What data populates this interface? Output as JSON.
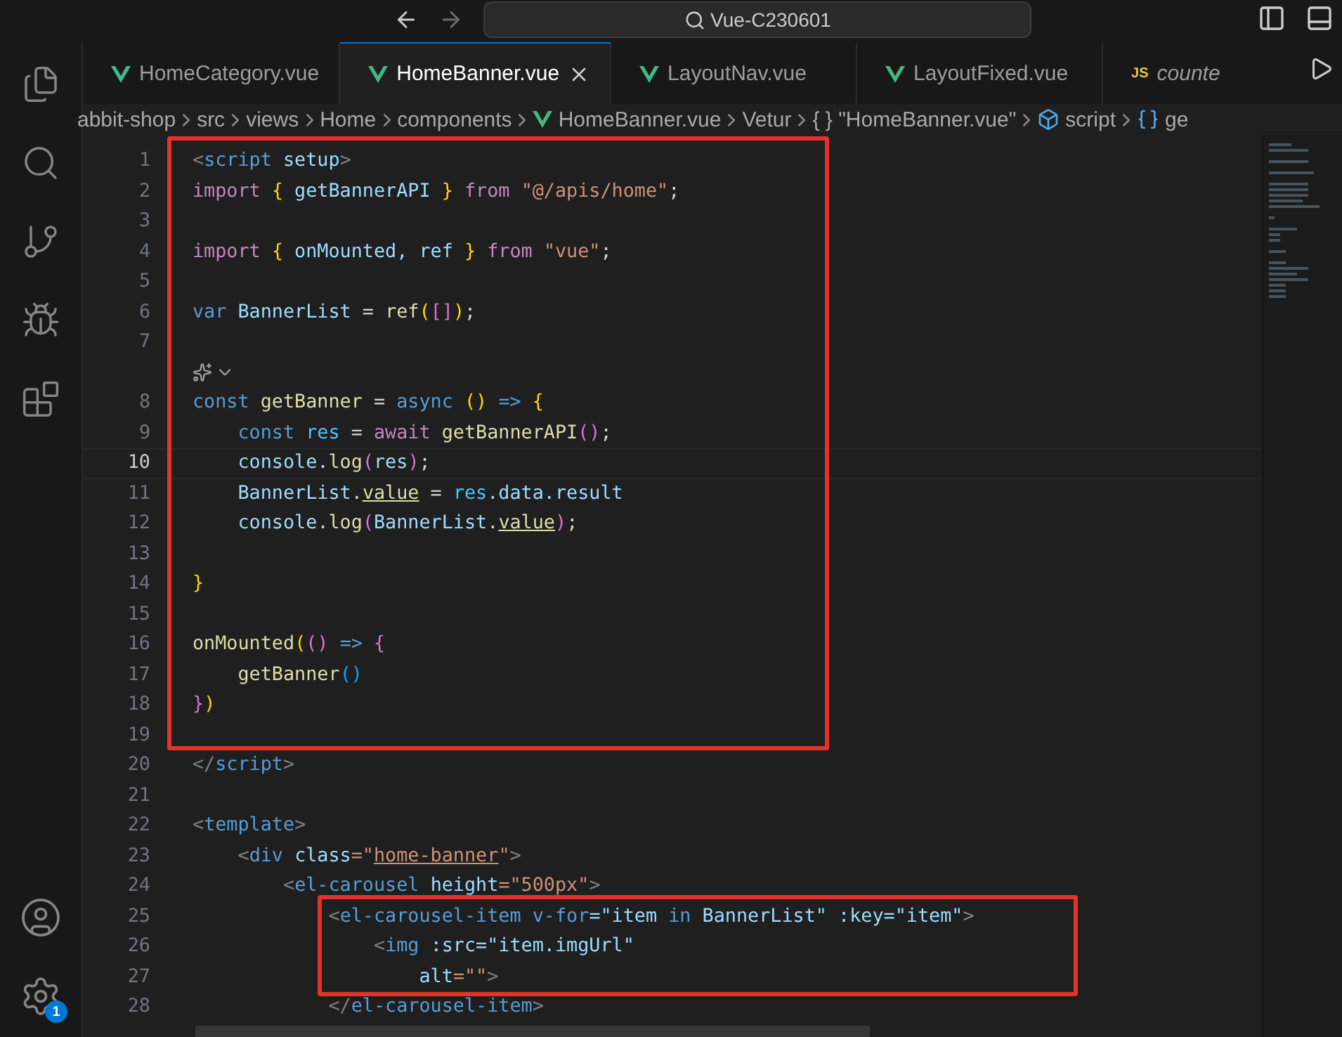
{
  "title_bar": {
    "search": "Vue-C230601"
  },
  "activity_bar": {
    "badge": "1"
  },
  "tabs": [
    {
      "label": "HomeCategory.vue",
      "kind": "vue",
      "selected": false
    },
    {
      "label": "HomeBanner.vue",
      "kind": "vue",
      "selected": true
    },
    {
      "label": "LayoutNav.vue",
      "kind": "vue",
      "selected": false
    },
    {
      "label": "LayoutFixed.vue",
      "kind": "vue",
      "selected": false
    },
    {
      "label": "counte",
      "kind": "js",
      "badge": "JS",
      "selected": false
    }
  ],
  "breadcrumb": [
    {
      "label": "abbit-shop",
      "kind": "plain"
    },
    {
      "label": "src",
      "kind": "plain"
    },
    {
      "label": "views",
      "kind": "plain"
    },
    {
      "label": "Home",
      "kind": "plain"
    },
    {
      "label": "components",
      "kind": "plain"
    },
    {
      "label": "HomeBanner.vue",
      "kind": "vue"
    },
    {
      "label": "Vetur",
      "kind": "plain"
    },
    {
      "label": "\"HomeBanner.vue\"",
      "kind": "braces",
      "prefix": "{ }"
    },
    {
      "label": "script",
      "kind": "cube"
    },
    {
      "label": "ge",
      "kind": "symbol"
    }
  ],
  "code_lines": [
    {
      "number": "1",
      "current": false,
      "tokens": [
        {
          "text": "<",
          "kind": "tag"
        },
        {
          "text": "script ",
          "kind": "tagname"
        },
        {
          "text": "setup",
          "kind": "attr"
        },
        {
          "text": ">",
          "kind": "tag"
        }
      ]
    },
    {
      "number": "2",
      "current": false,
      "tokens": [
        {
          "text": "import ",
          "kind": "kw"
        },
        {
          "text": "{",
          "kind": "b1"
        },
        {
          "text": " getBannerAPI ",
          "kind": "var"
        },
        {
          "text": "}",
          "kind": "b1"
        },
        {
          "text": " from ",
          "kind": "kw"
        },
        {
          "text": "\"@/apis/home\"",
          "kind": "str"
        },
        {
          "text": ";",
          "kind": "plain"
        }
      ]
    },
    {
      "number": "3",
      "current": false
    },
    {
      "number": "4",
      "current": false,
      "tokens": [
        {
          "text": "import ",
          "kind": "kw"
        },
        {
          "text": "{",
          "kind": "b1"
        },
        {
          "text": " onMounted, ref ",
          "kind": "var"
        },
        {
          "text": "}",
          "kind": "b1"
        },
        {
          "text": " from ",
          "kind": "kw"
        },
        {
          "text": "\"vue\"",
          "kind": "str"
        },
        {
          "text": ";",
          "kind": "plain"
        }
      ]
    },
    {
      "number": "5",
      "current": false
    },
    {
      "number": "6",
      "current": false,
      "tokens": [
        {
          "text": "var ",
          "kind": "decl"
        },
        {
          "text": "BannerList",
          "kind": "var"
        },
        {
          "text": " = ",
          "kind": "plain"
        },
        {
          "text": "ref",
          "kind": "fn"
        },
        {
          "text": "(",
          "kind": "b1"
        },
        {
          "text": "[]",
          "kind": "b2"
        },
        {
          "text": ")",
          "kind": "b1"
        },
        {
          "text": ";",
          "kind": "plain"
        }
      ]
    },
    {
      "number": "7",
      "current": false
    },
    {
      "number": "8",
      "current": false,
      "lens": true,
      "tokens": [
        {
          "text": "const ",
          "kind": "decl"
        },
        {
          "text": "getBanner",
          "kind": "fn"
        },
        {
          "text": " = ",
          "kind": "plain"
        },
        {
          "text": "async ",
          "kind": "decl"
        },
        {
          "text": "() ",
          "kind": "b1"
        },
        {
          "text": "=> ",
          "kind": "decl"
        },
        {
          "text": "{",
          "kind": "b1"
        }
      ]
    },
    {
      "number": "9",
      "current": false,
      "tokens": [
        {
          "text": "    const ",
          "kind": "decl"
        },
        {
          "text": "res",
          "kind": "const"
        },
        {
          "text": " = ",
          "kind": "plain"
        },
        {
          "text": "await ",
          "kind": "kw"
        },
        {
          "text": "getBannerAPI",
          "kind": "fn"
        },
        {
          "text": "()",
          "kind": "b2"
        },
        {
          "text": ";",
          "kind": "plain"
        }
      ]
    },
    {
      "number": "10",
      "current": true,
      "tokens": [
        {
          "text": "    console",
          "kind": "var"
        },
        {
          "text": ".",
          "kind": "plain"
        },
        {
          "text": "log",
          "kind": "fn"
        },
        {
          "text": "(",
          "kind": "b2"
        },
        {
          "text": "res",
          "kind": "var"
        },
        {
          "text": ")",
          "kind": "b2"
        },
        {
          "text": ";",
          "kind": "plain"
        }
      ]
    },
    {
      "number": "11",
      "current": false,
      "tokens": [
        {
          "text": "    BannerList",
          "kind": "var"
        },
        {
          "text": ".",
          "kind": "plain"
        },
        {
          "text": "value",
          "kind": "under"
        },
        {
          "text": " = ",
          "kind": "plain"
        },
        {
          "text": "res",
          "kind": "const"
        },
        {
          "text": ".data.result",
          "kind": "var"
        }
      ]
    },
    {
      "number": "12",
      "current": false,
      "tokens": [
        {
          "text": "    console",
          "kind": "var"
        },
        {
          "text": ".",
          "kind": "plain"
        },
        {
          "text": "log",
          "kind": "fn"
        },
        {
          "text": "(",
          "kind": "b2"
        },
        {
          "text": "BannerList",
          "kind": "var"
        },
        {
          "text": ".",
          "kind": "plain"
        },
        {
          "text": "value",
          "kind": "under"
        },
        {
          "text": ")",
          "kind": "b2"
        },
        {
          "text": ";",
          "kind": "plain"
        }
      ]
    },
    {
      "number": "13",
      "current": false
    },
    {
      "number": "14",
      "current": false,
      "tokens": [
        {
          "text": "}",
          "kind": "b1"
        }
      ]
    },
    {
      "number": "15",
      "current": false
    },
    {
      "number": "16",
      "current": false,
      "tokens": [
        {
          "text": "onMounted",
          "kind": "fn"
        },
        {
          "text": "(",
          "kind": "b1"
        },
        {
          "text": "() ",
          "kind": "b2"
        },
        {
          "text": "=> ",
          "kind": "decl"
        },
        {
          "text": "{",
          "kind": "b2"
        }
      ]
    },
    {
      "number": "17",
      "current": false,
      "tokens": [
        {
          "text": "    getBanner",
          "kind": "fn"
        },
        {
          "text": "()",
          "kind": "b3"
        }
      ]
    },
    {
      "number": "18",
      "current": false,
      "tokens": [
        {
          "text": "}",
          "kind": "b2"
        },
        {
          "text": ")",
          "kind": "b1"
        }
      ]
    },
    {
      "number": "19",
      "current": false
    },
    {
      "number": "20",
      "current": false,
      "tokens": [
        {
          "text": "</",
          "kind": "tag"
        },
        {
          "text": "script",
          "kind": "tagname"
        },
        {
          "text": ">",
          "kind": "tag"
        }
      ]
    },
    {
      "number": "21",
      "current": false
    },
    {
      "number": "22",
      "current": false,
      "tokens": [
        {
          "text": "<",
          "kind": "tag"
        },
        {
          "text": "template",
          "kind": "tagname"
        },
        {
          "text": ">",
          "kind": "tag"
        }
      ]
    },
    {
      "number": "23",
      "current": false,
      "tokens": [
        {
          "text": "    <",
          "kind": "tag"
        },
        {
          "text": "div ",
          "kind": "tagname"
        },
        {
          "text": "class",
          "kind": "attr"
        },
        {
          "text": "=\"",
          "kind": "str"
        },
        {
          "text": "home-banner",
          "kind": "strunder"
        },
        {
          "text": "\"",
          "kind": "str"
        },
        {
          "text": ">",
          "kind": "tag"
        }
      ]
    },
    {
      "number": "24",
      "current": false,
      "tokens": [
        {
          "text": "        <",
          "kind": "tag"
        },
        {
          "text": "el-carousel ",
          "kind": "tagname"
        },
        {
          "text": "height",
          "kind": "attr"
        },
        {
          "text": "=\"500px\"",
          "kind": "str"
        },
        {
          "text": ">",
          "kind": "tag"
        }
      ]
    },
    {
      "number": "25",
      "current": false,
      "tokens": [
        {
          "text": "            <",
          "kind": "tag"
        },
        {
          "text": "el-carousel-item ",
          "kind": "tagname"
        },
        {
          "text": "v-for",
          "kind": "decl"
        },
        {
          "text": "=\"item ",
          "kind": "attr"
        },
        {
          "text": "in",
          "kind": "decl"
        },
        {
          "text": " BannerList\" :key=\"item\"",
          "kind": "attr"
        },
        {
          "text": ">",
          "kind": "tag"
        }
      ]
    },
    {
      "number": "26",
      "current": false,
      "tokens": [
        {
          "text": "                <",
          "kind": "tag"
        },
        {
          "text": "img ",
          "kind": "tagname"
        },
        {
          "text": ":src=\"item.imgUrl\"",
          "kind": "attr"
        }
      ]
    },
    {
      "number": "27",
      "current": false,
      "tokens": [
        {
          "text": "                    alt",
          "kind": "attr"
        },
        {
          "text": "=\"\"",
          "kind": "str"
        },
        {
          "text": ">",
          "kind": "tag"
        }
      ]
    },
    {
      "number": "28",
      "current": false,
      "tokens": [
        {
          "text": "            </",
          "kind": "tag"
        },
        {
          "text": "el-carousel-item",
          "kind": "tagname"
        },
        {
          "text": ">",
          "kind": "tag"
        }
      ]
    }
  ]
}
